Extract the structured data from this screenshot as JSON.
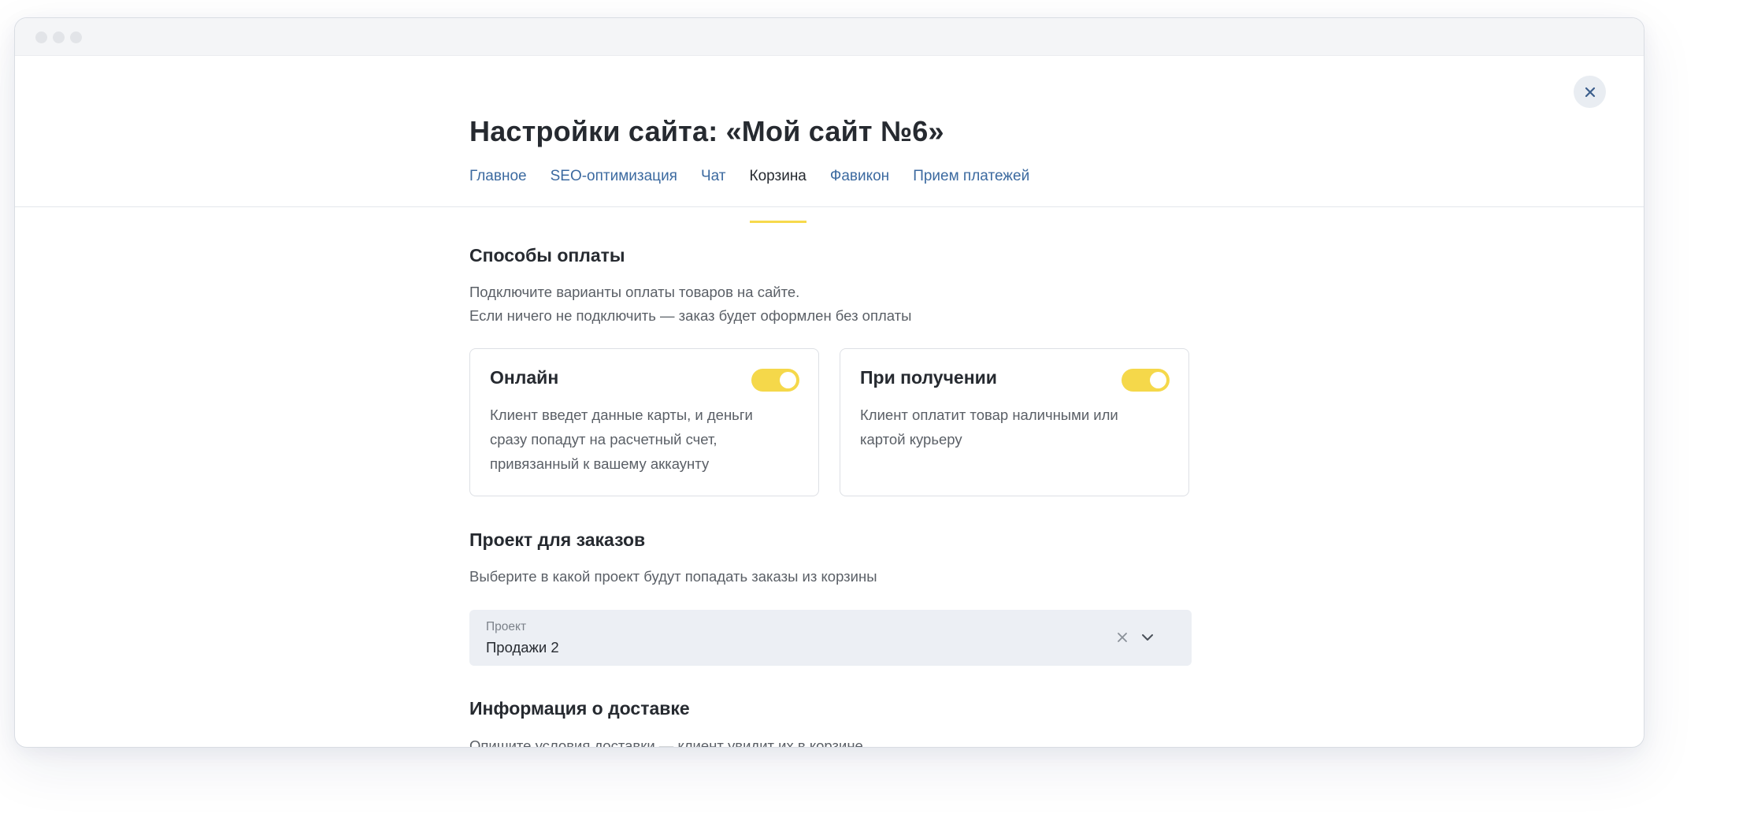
{
  "window": {
    "controls": [
      "close",
      "minimize",
      "maximize"
    ]
  },
  "header": {
    "title": "Настройки сайта: «Мой сайт №6»",
    "close_icon": "close-icon"
  },
  "tabs": [
    {
      "label": "Главное",
      "active": false
    },
    {
      "label": "SEO-оптимизация",
      "active": false
    },
    {
      "label": "Чат",
      "active": false
    },
    {
      "label": "Корзина",
      "active": true
    },
    {
      "label": "Фавикон",
      "active": false
    },
    {
      "label": "Прием платежей",
      "active": false
    }
  ],
  "payment": {
    "title": "Способы оплаты",
    "description_line1": "Подключите варианты оплаты товаров на сайте.",
    "description_line2": "Если ничего не подключить — заказ будет оформлен без оплаты",
    "cards": [
      {
        "title": "Онлайн",
        "enabled": true,
        "text": "Клиент введет данные карты, и деньги сразу попадут на расчетный счет, привязанный к вашему аккаунту"
      },
      {
        "title": "При получении",
        "enabled": true,
        "text": "Клиент оплатит товар наличными или картой курьеру"
      }
    ]
  },
  "orders_project": {
    "title": "Проект для заказов",
    "description": "Выберите в какой проект будут попадать заказы из корзины",
    "select": {
      "label": "Проект",
      "value": "Продажи 2"
    }
  },
  "delivery": {
    "title": "Информация о доставке",
    "description": "Опишите условия доставки — клиент увидит их в корзине"
  },
  "colors": {
    "accent_yellow": "#f5d84a",
    "link_blue": "#3c6aa0",
    "field_bg": "#eceff4",
    "text_dark": "#262a30",
    "text_muted": "#5a5f66"
  }
}
